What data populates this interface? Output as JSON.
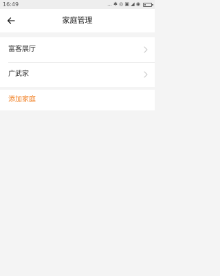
{
  "status_bar": {
    "time": "16:49",
    "icons_text": "... ✱ ◎ ▣ ◢ ◉",
    "icons": [
      "dots-icon",
      "bluetooth-icon",
      "alarm-icon",
      "sim-icon",
      "signal-icon",
      "wifi-icon",
      "battery-icon"
    ],
    "battery_level": 0.2
  },
  "header": {
    "title": "家庭管理",
    "back_icon": "arrow-left-icon"
  },
  "homes": [
    {
      "label": "富客展厅"
    },
    {
      "label": "广武家"
    }
  ],
  "add_home": {
    "label": "添加家庭",
    "color": "#f07a1a"
  },
  "colors": {
    "background": "#f4f4f4",
    "card": "#ffffff",
    "accent": "#f07a1a"
  }
}
